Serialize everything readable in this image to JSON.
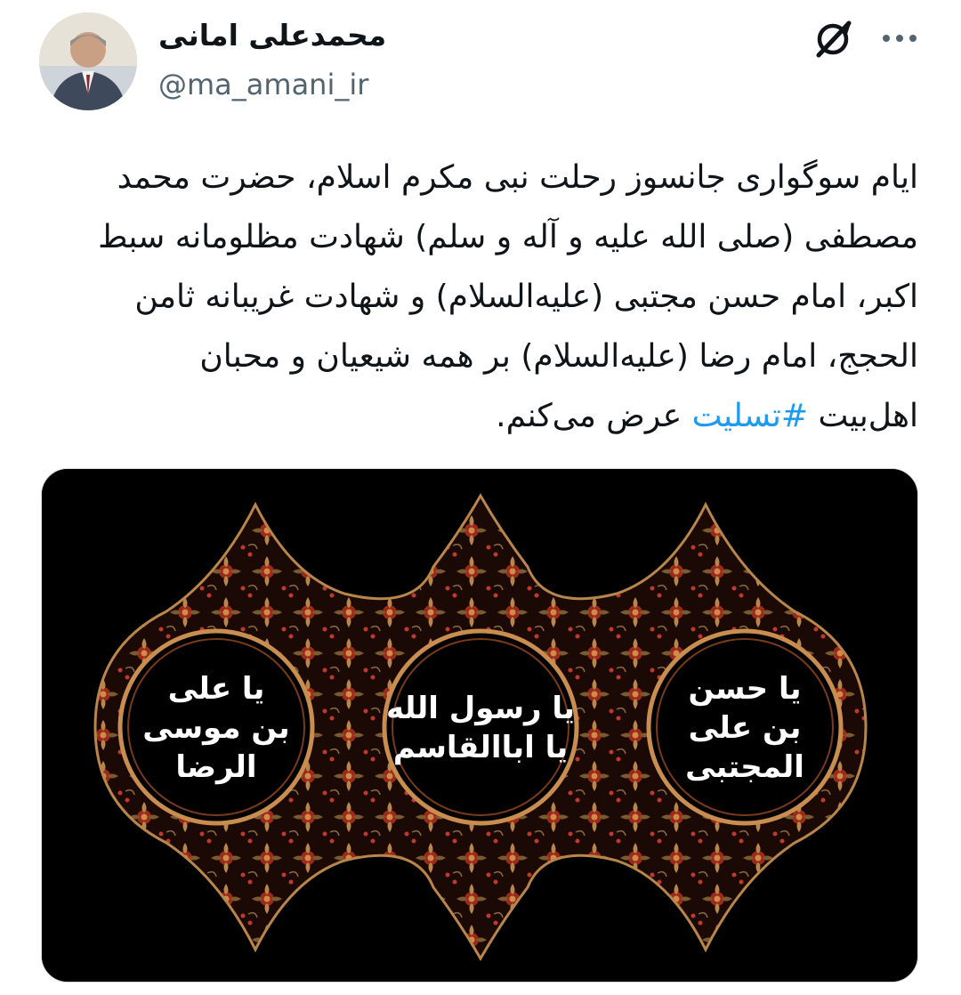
{
  "author": {
    "display_name": "محمدعلی امانی",
    "handle": "@ma_amani_ir"
  },
  "icons": {
    "grok": "grok-icon",
    "more": "more-icon"
  },
  "tweet": {
    "lines": [
      "ایام سوگواری جانسوز رحلت نبی مکرم اسلام، حضرت محمد",
      "مصطفی (صلی الله علیه و آله و سلم)  شهادت مظلومانه سبط",
      "اکبر، امام حسن مجتبی (علیه‌السلام) و شهادت غریبانه ثامن",
      "الحجج، امام رضا (علیه‌السلام) بر همه شیعیان و محبان"
    ],
    "last_line_before": "اهل‌بیت ",
    "hashtag": "#تسلیت",
    "last_line_after": " عرض می‌کنم."
  },
  "media": {
    "medallions": [
      {
        "line1": "یا حسن",
        "line2": "بن علی",
        "line3": "المجتبی"
      },
      {
        "line1": "یا رسول الله",
        "line2": "یا اباالقاسم",
        "line3": ""
      },
      {
        "line1": "یا علی",
        "line2": "بن موسی",
        "line3": "الرضا"
      }
    ],
    "colors": {
      "background": "#000000",
      "gold": "#b8864a",
      "red": "#9c2a1a",
      "ring": "#c98e4f"
    }
  },
  "colors": {
    "hashtag": "#1d9bf0",
    "handle": "#536471",
    "text": "#0f1419"
  }
}
